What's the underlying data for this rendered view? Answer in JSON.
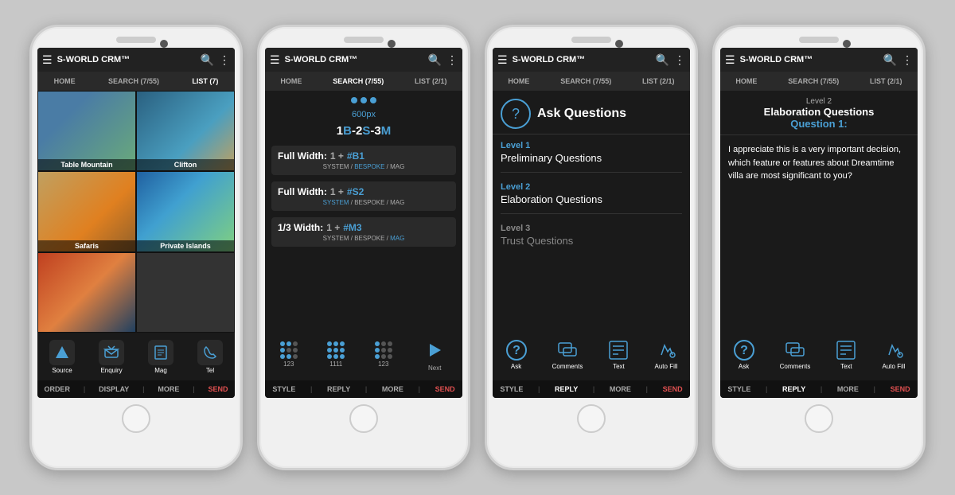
{
  "app": {
    "title": "S-WORLD CRM™",
    "nav": {
      "home": "HOME",
      "search": "SEARCH (7/55)",
      "list1": "LIST (7)",
      "list2": "LIST (2/1)"
    }
  },
  "phone1": {
    "grid": [
      {
        "label": "Table Mountain",
        "img": "mountain"
      },
      {
        "label": "Clifton",
        "img": "clifton"
      },
      {
        "label": "Safaris",
        "img": "safari"
      },
      {
        "label": "Private Islands",
        "img": "islands"
      },
      {
        "label": "",
        "img": "sunset"
      },
      {
        "label": "",
        "img": "empty"
      }
    ],
    "bottomIcons": [
      {
        "icon": "📤",
        "label": "Source"
      },
      {
        "icon": "✈️",
        "label": "Enquiry"
      },
      {
        "icon": "📖",
        "label": "Mag"
      },
      {
        "icon": "📞",
        "label": "Tel"
      }
    ],
    "actionBar": [
      "ORDER",
      "DISPLAY",
      "MORE",
      "SEND"
    ]
  },
  "phone2": {
    "pxLabel": "600px",
    "styleCode": "1B-2S-3M",
    "rows": [
      {
        "label": "Full Width:",
        "val": "1",
        "hash": "#B1",
        "sub": "SYSTEM / BESPOKE / MAG",
        "bespoke": true
      },
      {
        "label": "Full Width:",
        "val": "1",
        "hash": "#S2",
        "sub": "SYSTEM / BESPOKE / MAG",
        "system": true
      },
      {
        "label": "1/3 Width:",
        "val": "1",
        "hash": "#M3",
        "sub": "SYSTEM / BESPOKE / MAG",
        "mag": true
      }
    ],
    "bottomIcons": [
      {
        "val": "123",
        "type": "dots1"
      },
      {
        "val": "1111",
        "type": "dots2"
      },
      {
        "val": "123",
        "type": "dots3"
      },
      {
        "val": "Next",
        "type": "next"
      }
    ],
    "actionBar": [
      "STYLE",
      "REPLY",
      "MORE",
      "SEND"
    ]
  },
  "phone3": {
    "headerTitle": "Ask Questions",
    "levels": [
      {
        "num": "Level 1",
        "name": "Preliminary Questions",
        "active": true
      },
      {
        "num": "Level 2",
        "name": "Elaboration Questions",
        "active": true
      },
      {
        "num": "Level 3",
        "name": "Trust Questions",
        "active": false
      }
    ],
    "bottomIcons": [
      {
        "label": "Ask"
      },
      {
        "label": "Comments"
      },
      {
        "label": "Text"
      },
      {
        "label": "Auto Fill"
      }
    ],
    "actionBar": [
      "STYLE",
      "REPLY",
      "MORE",
      "SEND"
    ]
  },
  "phone4": {
    "levelNum": "Level 2",
    "levelType": "Elaboration Questions",
    "questionLabel": "Question 1:",
    "questionText": "I appreciate this is a very important decision, which feature or features about Dreamtime villa are most significant to you?",
    "bottomIcons": [
      {
        "label": "Ask"
      },
      {
        "label": "Comments"
      },
      {
        "label": "Text"
      },
      {
        "label": "Auto Fill"
      }
    ],
    "actionBar": [
      "STYLE",
      "REPLY",
      "MORE",
      "SEND"
    ]
  }
}
